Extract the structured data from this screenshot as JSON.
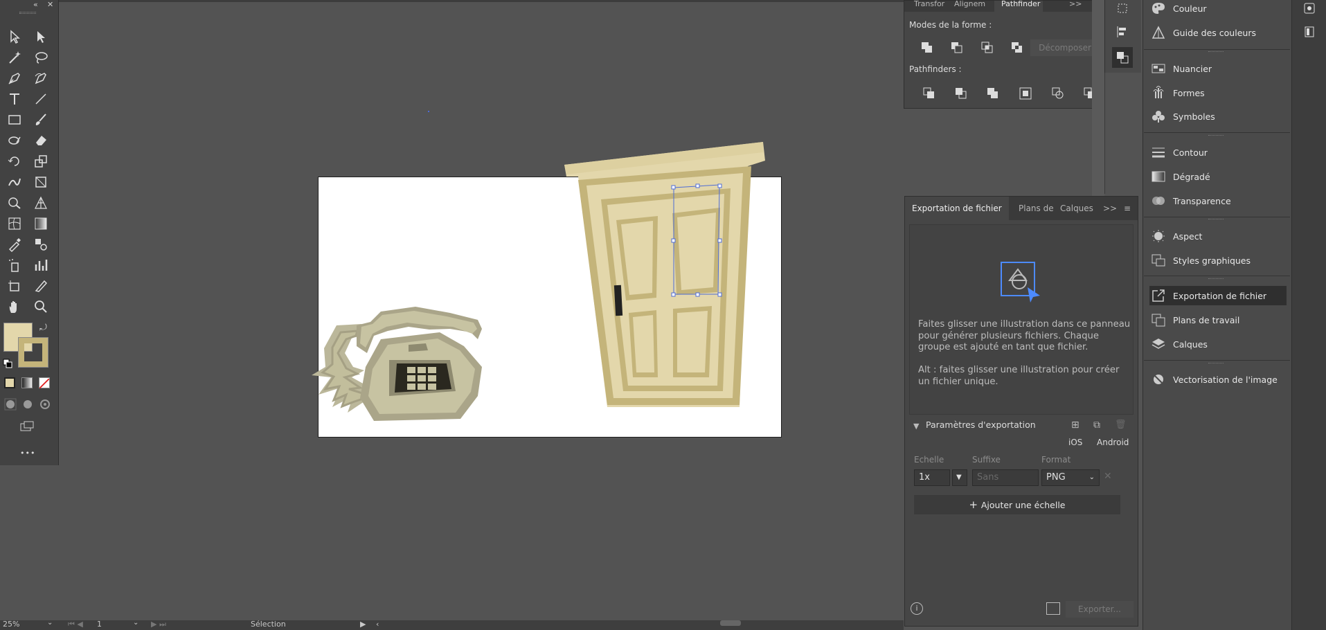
{
  "tools": {
    "collapse_label": "«",
    "close_label": "✕",
    "more_label": "•••"
  },
  "pathfinder": {
    "tabs": [
      "Transfor",
      "Alignem",
      "Pathfinder"
    ],
    "tab_overflow": ">>",
    "shape_modes_label": "Modes de la forme :",
    "expand_button": "Décomposer",
    "pathfinders_label": "Pathfinders :"
  },
  "export": {
    "tabs": [
      "Exportation de fichier",
      "Plans de",
      "Calques"
    ],
    "tab_overflow": ">>",
    "drop_text_1": "Faites glisser une illustration dans ce panneau pour générer plusieurs fichiers. Chaque groupe est ajouté en tant que fichier.",
    "drop_text_2": "Alt : faites glisser une illustration pour créer un fichier unique.",
    "settings_label": "Paramètres d'exportation",
    "ios_label": "iOS",
    "android_label": "Android",
    "scale_label": "Echelle",
    "suffix_label": "Suffixe",
    "format_label": "Format",
    "scale_value": "1x",
    "suffix_placeholder": "Sans",
    "format_value": "PNG",
    "add_scale_button": "Ajouter une échelle",
    "export_button": "Exporter..."
  },
  "dock": {
    "items": [
      {
        "label": "Couleur",
        "icon": "palette-icon"
      },
      {
        "label": "Guide des couleurs",
        "icon": "color-guide-icon"
      },
      {
        "label": "Nuancier",
        "icon": "swatches-icon"
      },
      {
        "label": "Formes",
        "icon": "brushes-icon"
      },
      {
        "label": "Symboles",
        "icon": "symbols-icon"
      },
      {
        "label": "Contour",
        "icon": "stroke-icon"
      },
      {
        "label": "Dégradé",
        "icon": "gradient-icon"
      },
      {
        "label": "Transparence",
        "icon": "transparency-icon"
      },
      {
        "label": "Aspect",
        "icon": "appearance-icon"
      },
      {
        "label": "Styles graphiques",
        "icon": "graphic-styles-icon"
      },
      {
        "label": "Exportation de fichier",
        "icon": "export-icon"
      },
      {
        "label": "Plans de travail",
        "icon": "artboards-icon"
      },
      {
        "label": "Calques",
        "icon": "layers-icon"
      },
      {
        "label": "Vectorisation de l'image",
        "icon": "image-trace-icon"
      }
    ]
  },
  "status": {
    "zoom": "25%",
    "artboard_num": "1",
    "tool_name": "Sélection"
  },
  "colors": {
    "fill": "#e3d7ab",
    "stroke": "#c4b47a",
    "selection": "#4d6bd6"
  }
}
